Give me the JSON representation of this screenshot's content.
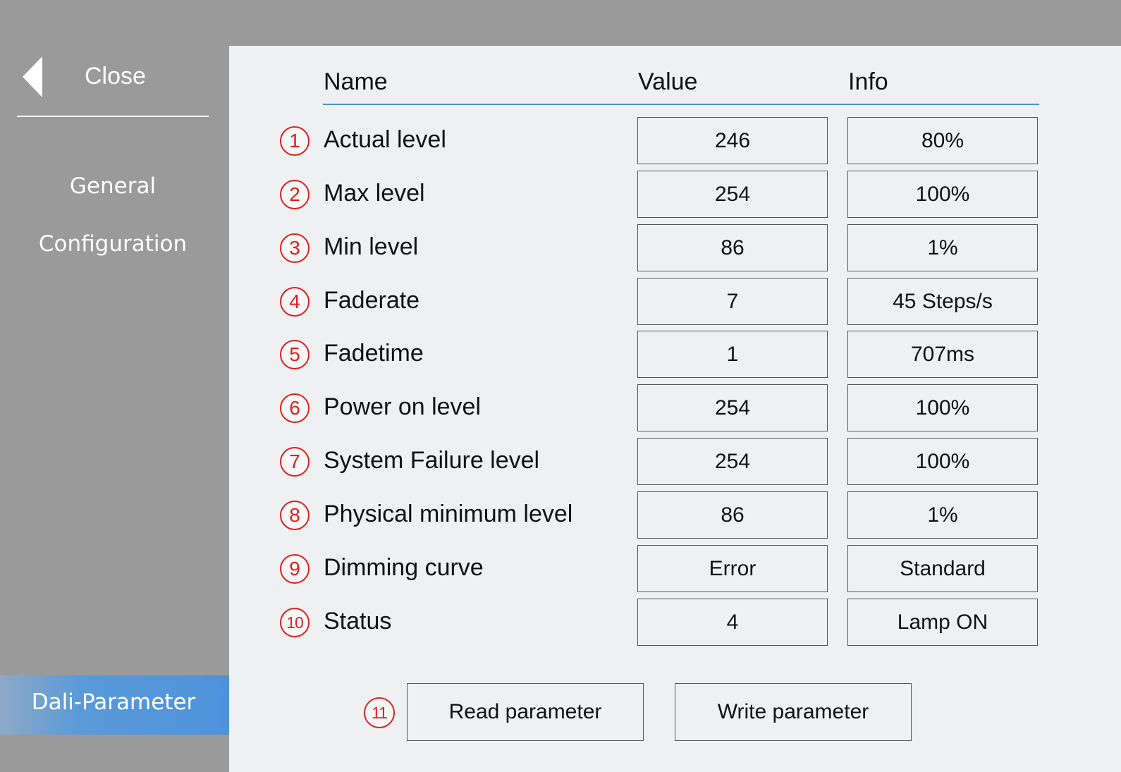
{
  "sidebar": {
    "close_label": "Close",
    "items": [
      {
        "label": "General"
      },
      {
        "label": "Configuration"
      },
      {
        "label": "Dali-Parameter",
        "active": true
      }
    ],
    "active_color": "#4a90dc"
  },
  "table": {
    "headers": {
      "name": "Name",
      "value": "Value",
      "info": "Info"
    },
    "rows": [
      {
        "num": "1",
        "name": "Actual level",
        "value": "246",
        "info": "80%"
      },
      {
        "num": "2",
        "name": "Max level",
        "value": "254",
        "info": "100%"
      },
      {
        "num": "3",
        "name": "Min level",
        "value": "86",
        "info": "1%"
      },
      {
        "num": "4",
        "name": "Faderate",
        "value": "7",
        "info": "45 Steps/s"
      },
      {
        "num": "5",
        "name": "Fadetime",
        "value": "1",
        "info": "707ms"
      },
      {
        "num": "6",
        "name": "Power on level",
        "value": "254",
        "info": "100%"
      },
      {
        "num": "7",
        "name": "System Failure level",
        "value": "254",
        "info": "100%"
      },
      {
        "num": "8",
        "name": "Physical minimum level",
        "value": "86",
        "info": "1%"
      },
      {
        "num": "9",
        "name": "Dimming curve",
        "value": "Error",
        "info": "Standard"
      },
      {
        "num": "10",
        "name": "Status",
        "value": "4",
        "info": "Lamp ON"
      }
    ]
  },
  "actions": {
    "badge": "11",
    "read_label": "Read parameter",
    "write_label": "Write parameter"
  },
  "colors": {
    "annotation": "#e02020",
    "header_line": "#4a90d0",
    "sidebar_bg": "#9a9a9a",
    "content_bg": "#eff0f2"
  }
}
